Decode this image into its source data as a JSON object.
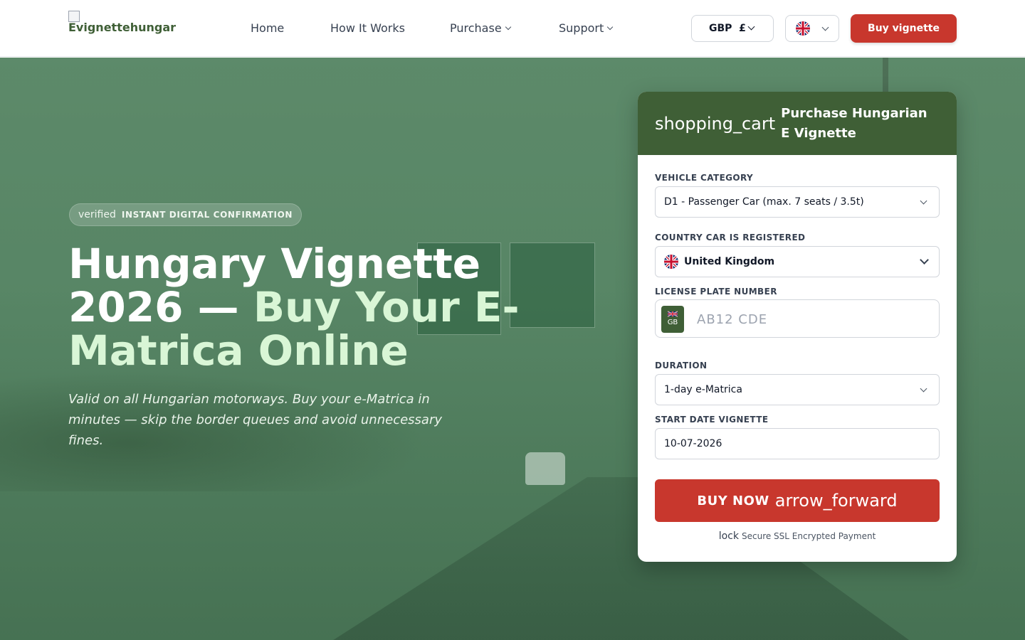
{
  "header": {
    "logo_alt": "Evignettehungar",
    "nav": [
      {
        "label": "Home"
      },
      {
        "label": "How It Works"
      },
      {
        "label": "Purchase"
      },
      {
        "label": "Support"
      }
    ],
    "currency": "GBP  £",
    "buy_label": "Buy vignette"
  },
  "hero": {
    "badge_icon": "verified",
    "badge_text": "INSTANT DIGITAL CONFIRMATION",
    "title_main": "Hungary Vignette 2026 — ",
    "title_accent": "Buy Your E-Matrica Online",
    "subtitle": "Valid on all Hungarian motorways. Buy your e-Matrica in minutes — skip the border queues and avoid unnecessary fines."
  },
  "form": {
    "header_icon": "shopping_cart",
    "header_title": "Purchase Hungarian E Vignette",
    "vehicle_label": "VEHICLE CATEGORY",
    "vehicle_value": "D1 - Passenger Car (max. 7 seats / 3.5t)",
    "country_label": "COUNTRY CAR IS REGISTERED",
    "country_value": "United Kingdom",
    "plate_label": "LICENSE PLATE NUMBER",
    "plate_country_code": "GB",
    "plate_placeholder": "AB12 CDE",
    "duration_label": "DURATION",
    "duration_value": "1-day e-Matrica",
    "start_label": "START DATE VIGNETTE",
    "start_value": "10-07-2026",
    "buy_now_label": "BUY NOW",
    "buy_now_icon": "arrow_forward",
    "secure_icon": "lock",
    "secure_text": "Secure SSL Encrypted Payment"
  },
  "colors": {
    "brand_green": "#3f5f36",
    "accent_red": "#c8372d",
    "hero_accent": "#d9f6d6"
  }
}
